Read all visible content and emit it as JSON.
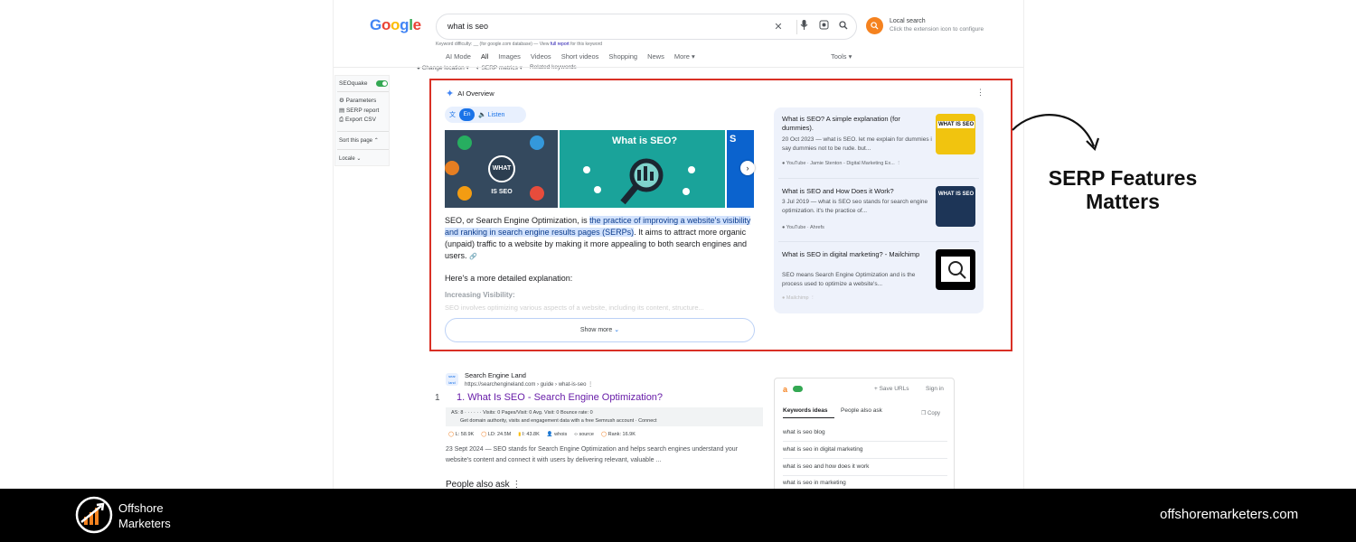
{
  "header": {
    "logo": "Google",
    "query": "what is seo",
    "local_search_title": "Local search",
    "local_search_hint": "Click the extension icon to configure",
    "keyword_difficulty": "Keyword difficulty: __ (for google.com database) — View",
    "kd_link": "full report",
    "kd_tail": "for this keyword",
    "tabs": [
      "AI Mode",
      "All",
      "Images",
      "Videos",
      "Short videos",
      "Shopping",
      "News",
      "More ▾"
    ],
    "tools": "Tools ▾",
    "subnav": [
      "Change location ▾",
      "SERP metrics ▾",
      "Related keywords"
    ]
  },
  "seoquake": {
    "title": "SEOquake",
    "items": [
      "Parameters",
      "SERP report",
      "Export CSV"
    ],
    "sort": "Sort this page ⌃",
    "locale": "Locale ⌄"
  },
  "ai_overview": {
    "title": "AI Overview",
    "lang": "En",
    "listen": "Listen",
    "image_title": "What is SEO?",
    "hub_label": "WHAT IS SEO",
    "para_start": "SEO, or Search Engine Optimization, is ",
    "para_highlight": "the practice of improving a website's visibility and ranking in search engine results pages (SERPs)",
    "para_end": ". It aims to attract more organic (unpaid) traffic to a website by making it more appealing to both search engines and users.",
    "subheading": "Here's a more detailed explanation:",
    "inc_vis": "Increasing Visibility:",
    "faded_line": "SEO involves optimizing various aspects of a website, including its content, structure...",
    "show_more": "Show more",
    "sources": [
      {
        "title": "What is SEO? A simple explanation (for dummies).",
        "snippet": "20 Oct 2023 — what is SEO. let me explain for dummies i say dummies not to be rude. but...",
        "meta": "YouTube · Jamie Stenton - Digital Marketing Ex...",
        "thumb": "WHAT IS SEO"
      },
      {
        "title": "What is SEO and How Does it Work?",
        "snippet": "3 Jul 2019 — what is SEO seo stands for search engine optimization. it's the practice of...",
        "meta": "YouTube · Ahrefs",
        "thumb": "WHAT IS SEO"
      },
      {
        "title": "What is SEO in digital marketing? - Mailchimp",
        "snippet": "SEO means Search Engine Optimization and is the process used to optimize a website's...",
        "meta": "Mailchimp",
        "thumb": ""
      }
    ]
  },
  "result": {
    "site": "Search Engine Land",
    "url": "https://searchengineland.com › guide › what-is-seo",
    "number": "1",
    "title": "1. What Is SEO - Search Engine Optimization?",
    "semrush_row1": "AS: 8 · · · · · ·    Visits: 0    Pages/Visit: 0    Avg. Visit: 0    Bounce rate: 0",
    "semrush_row2": "Get domain authority, visits and engagement data with a free Semrush account · Connect",
    "metrics": [
      "L: 58.9K",
      "LD: 24.5M",
      "I: 43.8K",
      "whois",
      "source",
      "Rank: 16.9K"
    ],
    "snippet": "23 Sept 2024 — SEO stands for Search Engine Optimization and helps search engines understand your website's content and connect it with users by delivering relevant, valuable ...",
    "paa": "People also ask ⋮"
  },
  "keywords": {
    "save_urls": "+ Save URLs",
    "sign_in": "Sign in",
    "tab1": "Keywords ideas",
    "tab2": "People also ask",
    "copy": "Copy",
    "items": [
      "what is seo blog",
      "what is seo in digital marketing",
      "what is seo and how does it work",
      "what is seo in marketing"
    ]
  },
  "annotation": {
    "line1": "SERP Features",
    "line2": "Matters"
  },
  "footer": {
    "brand_line1": "Offshore",
    "brand_line2": "Marketers",
    "url": "offshoremarketers.com"
  },
  "colors": {
    "accent_red": "#d93025",
    "footer_bg": "#000000",
    "link_purple": "#681da8",
    "brand_orange": "#f5821f"
  }
}
